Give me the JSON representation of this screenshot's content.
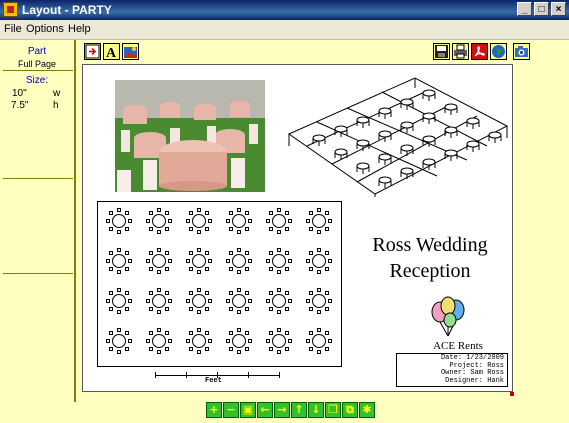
{
  "window": {
    "title": "Layout - PARTY"
  },
  "menu": {
    "items": [
      "File",
      "Options",
      "Help"
    ]
  },
  "sidebar": {
    "part_label": "Part",
    "part_value": "Full Page",
    "size_label": "Size:",
    "width_value": "10\"",
    "width_unit": "w",
    "height_value": "7.5\"",
    "height_unit": "h"
  },
  "toolbar": {
    "left_icons": [
      "insert-frame-icon",
      "text-icon",
      "add-image-icon"
    ],
    "right_icons": [
      "save-icon",
      "print-icon",
      "pdf-icon",
      "globe-icon",
      "camera-icon"
    ]
  },
  "layout": {
    "heading_line1": "Ross Wedding",
    "heading_line2": "Reception",
    "company": "ACE Rents",
    "info": [
      {
        "label": "Date:",
        "value": "1/23/2009"
      },
      {
        "label": "Project:",
        "value": "Ross"
      },
      {
        "label": "Owner:",
        "value": "Sam Ross"
      },
      {
        "label": "Designer:",
        "value": "Hank"
      }
    ],
    "scale_label": "Feet",
    "table_grid": {
      "rows": 4,
      "cols": 6
    }
  },
  "navbar": {
    "buttons": [
      {
        "name": "zoom-in-icon",
        "glyph": "+"
      },
      {
        "name": "zoom-out-icon",
        "glyph": "−"
      },
      {
        "name": "fit-page-icon",
        "glyph": "▣"
      },
      {
        "name": "pan-left-icon",
        "glyph": "←"
      },
      {
        "name": "pan-right-icon",
        "glyph": "→"
      },
      {
        "name": "pan-up-icon",
        "glyph": "↑"
      },
      {
        "name": "pan-down-icon",
        "glyph": "↓"
      },
      {
        "name": "copy-icon",
        "glyph": "❐"
      },
      {
        "name": "paste-icon",
        "glyph": "⧉"
      },
      {
        "name": "refresh-icon",
        "glyph": "✱"
      }
    ]
  },
  "colors": {
    "client_bg": "#ffffc0",
    "title_bar": "#0a246a",
    "nav_green": "#30c030"
  }
}
